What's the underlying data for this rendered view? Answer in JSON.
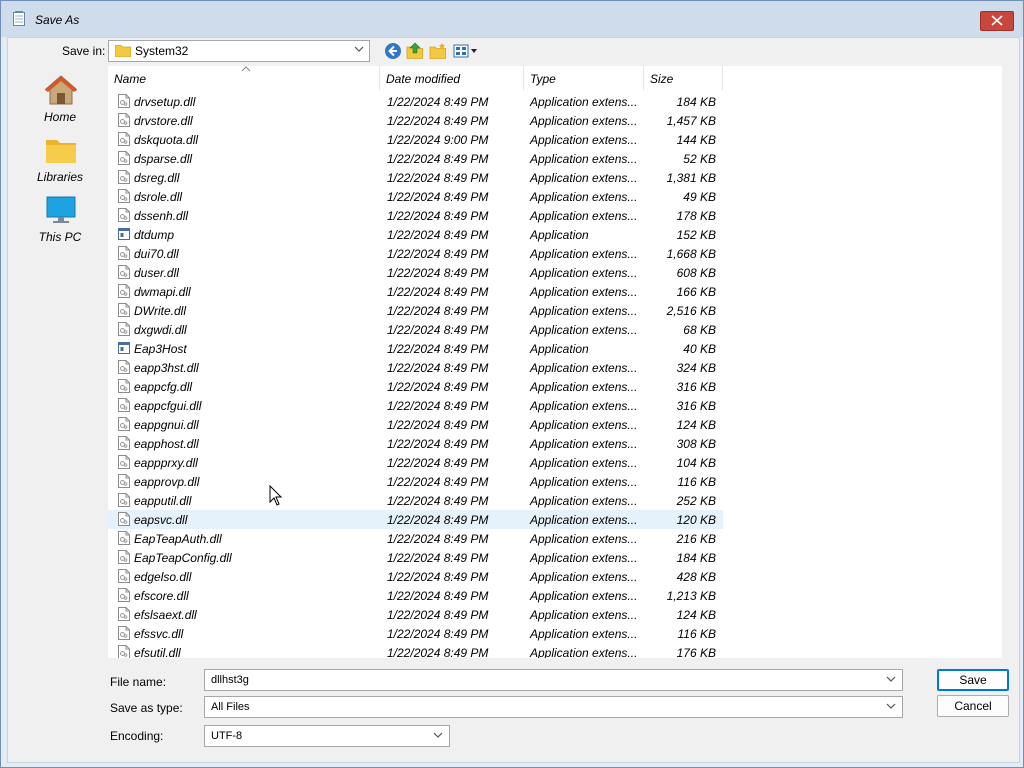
{
  "window": {
    "title": "Save As",
    "title_icon": "notepad-icon",
    "close_icon": "close-icon"
  },
  "toolbar": {
    "save_in_label": "Save in:",
    "save_in_value": "System32",
    "icons": [
      "back-icon",
      "up-folder-icon",
      "new-folder-icon",
      "view-menu-icon"
    ]
  },
  "places": [
    {
      "label": "Home",
      "icon": "home-icon"
    },
    {
      "label": "Libraries",
      "icon": "libraries-icon"
    },
    {
      "label": "This PC",
      "icon": "this-pc-icon"
    }
  ],
  "columns": {
    "name": "Name",
    "date": "Date modified",
    "type": "Type",
    "size": "Size"
  },
  "files": [
    {
      "name": "drvsetup.dll",
      "date": "1/22/2024 8:49 PM",
      "type": "Application extens...",
      "size": "184 KB",
      "kind": "dll"
    },
    {
      "name": "drvstore.dll",
      "date": "1/22/2024 8:49 PM",
      "type": "Application extens...",
      "size": "1,457 KB",
      "kind": "dll"
    },
    {
      "name": "dskquota.dll",
      "date": "1/22/2024 9:00 PM",
      "type": "Application extens...",
      "size": "144 KB",
      "kind": "dll"
    },
    {
      "name": "dsparse.dll",
      "date": "1/22/2024 8:49 PM",
      "type": "Application extens...",
      "size": "52 KB",
      "kind": "dll"
    },
    {
      "name": "dsreg.dll",
      "date": "1/22/2024 8:49 PM",
      "type": "Application extens...",
      "size": "1,381 KB",
      "kind": "dll"
    },
    {
      "name": "dsrole.dll",
      "date": "1/22/2024 8:49 PM",
      "type": "Application extens...",
      "size": "49 KB",
      "kind": "dll"
    },
    {
      "name": "dssenh.dll",
      "date": "1/22/2024 8:49 PM",
      "type": "Application extens...",
      "size": "178 KB",
      "kind": "dll"
    },
    {
      "name": "dtdump",
      "date": "1/22/2024 8:49 PM",
      "type": "Application",
      "size": "152 KB",
      "kind": "exe"
    },
    {
      "name": "dui70.dll",
      "date": "1/22/2024 8:49 PM",
      "type": "Application extens...",
      "size": "1,668 KB",
      "kind": "dll"
    },
    {
      "name": "duser.dll",
      "date": "1/22/2024 8:49 PM",
      "type": "Application extens...",
      "size": "608 KB",
      "kind": "dll"
    },
    {
      "name": "dwmapi.dll",
      "date": "1/22/2024 8:49 PM",
      "type": "Application extens...",
      "size": "166 KB",
      "kind": "dll"
    },
    {
      "name": "DWrite.dll",
      "date": "1/22/2024 8:49 PM",
      "type": "Application extens...",
      "size": "2,516 KB",
      "kind": "dll"
    },
    {
      "name": "dxgwdi.dll",
      "date": "1/22/2024 8:49 PM",
      "type": "Application extens...",
      "size": "68 KB",
      "kind": "dll"
    },
    {
      "name": "Eap3Host",
      "date": "1/22/2024 8:49 PM",
      "type": "Application",
      "size": "40 KB",
      "kind": "exe"
    },
    {
      "name": "eapp3hst.dll",
      "date": "1/22/2024 8:49 PM",
      "type": "Application extens...",
      "size": "324 KB",
      "kind": "dll"
    },
    {
      "name": "eappcfg.dll",
      "date": "1/22/2024 8:49 PM",
      "type": "Application extens...",
      "size": "316 KB",
      "kind": "dll"
    },
    {
      "name": "eappcfgui.dll",
      "date": "1/22/2024 8:49 PM",
      "type": "Application extens...",
      "size": "316 KB",
      "kind": "dll"
    },
    {
      "name": "eappgnui.dll",
      "date": "1/22/2024 8:49 PM",
      "type": "Application extens...",
      "size": "124 KB",
      "kind": "dll"
    },
    {
      "name": "eapphost.dll",
      "date": "1/22/2024 8:49 PM",
      "type": "Application extens...",
      "size": "308 KB",
      "kind": "dll"
    },
    {
      "name": "eappprxy.dll",
      "date": "1/22/2024 8:49 PM",
      "type": "Application extens...",
      "size": "104 KB",
      "kind": "dll"
    },
    {
      "name": "eapprovp.dll",
      "date": "1/22/2024 8:49 PM",
      "type": "Application extens...",
      "size": "116 KB",
      "kind": "dll"
    },
    {
      "name": "eapputil.dll",
      "date": "1/22/2024 8:49 PM",
      "type": "Application extens...",
      "size": "252 KB",
      "kind": "dll"
    },
    {
      "name": "eapsvc.dll",
      "date": "1/22/2024 8:49 PM",
      "type": "Application extens...",
      "size": "120 KB",
      "kind": "dll",
      "hover": true
    },
    {
      "name": "EapTeapAuth.dll",
      "date": "1/22/2024 8:49 PM",
      "type": "Application extens...",
      "size": "216 KB",
      "kind": "dll"
    },
    {
      "name": "EapTeapConfig.dll",
      "date": "1/22/2024 8:49 PM",
      "type": "Application extens...",
      "size": "184 KB",
      "kind": "dll"
    },
    {
      "name": "edgelso.dll",
      "date": "1/22/2024 8:49 PM",
      "type": "Application extens...",
      "size": "428 KB",
      "kind": "dll"
    },
    {
      "name": "efscore.dll",
      "date": "1/22/2024 8:49 PM",
      "type": "Application extens...",
      "size": "1,213 KB",
      "kind": "dll"
    },
    {
      "name": "efslsaext.dll",
      "date": "1/22/2024 8:49 PM",
      "type": "Application extens...",
      "size": "124 KB",
      "kind": "dll"
    },
    {
      "name": "efssvc.dll",
      "date": "1/22/2024 8:49 PM",
      "type": "Application extens...",
      "size": "116 KB",
      "kind": "dll"
    },
    {
      "name": "efsutil.dll",
      "date": "1/22/2024 8:49 PM",
      "type": "Application extens...",
      "size": "176 KB",
      "kind": "dll"
    }
  ],
  "form": {
    "file_name_label": "File name:",
    "file_name_value": "dllhst3g",
    "save_as_type_label": "Save as type:",
    "save_as_type_value": "All Files",
    "encoding_label": "Encoding:",
    "encoding_value": "UTF-8"
  },
  "buttons": {
    "save": "Save",
    "cancel": "Cancel"
  },
  "colors": {
    "hover_row": "#e5f1fb",
    "close_button": "#c8463c",
    "default_button_border": "#0078d7"
  }
}
